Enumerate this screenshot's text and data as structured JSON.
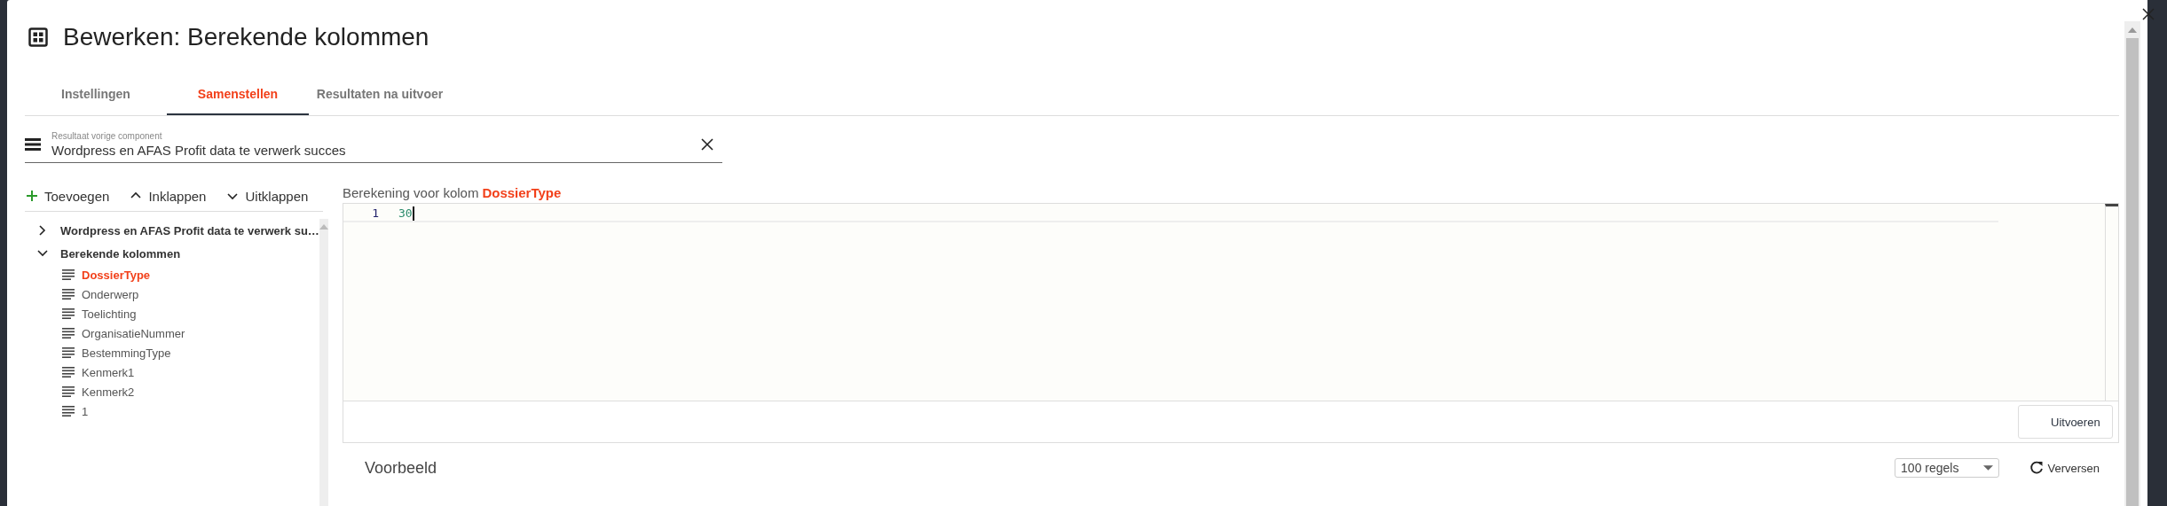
{
  "dialog": {
    "title": "Bewerken: Berekende kolommen"
  },
  "tabs": [
    {
      "label": "Instellingen",
      "selected": false
    },
    {
      "label": "Samenstellen",
      "selected": true
    },
    {
      "label": "Resultaten na uitvoer",
      "selected": false
    }
  ],
  "source_field": {
    "label": "Resultaat vorige component",
    "value": "Wordpress en AFAS Profit data te verwerk succes"
  },
  "toolbar": [
    {
      "label": "Toevoegen",
      "kind": "add"
    },
    {
      "label": "Inklappen",
      "kind": "collapse"
    },
    {
      "label": "Uitklappen",
      "kind": "expand"
    }
  ],
  "tree": [
    {
      "label": "Wordpress en AFAS Profit data te verwerk su…",
      "expanded": false
    },
    {
      "label": "Berekende kolommen",
      "expanded": true,
      "children": [
        {
          "label": "DossierType",
          "selected": true
        },
        {
          "label": "Onderwerp",
          "selected": false
        },
        {
          "label": "Toelichting",
          "selected": false
        },
        {
          "label": "OrganisatieNummer",
          "selected": false
        },
        {
          "label": "BestemmingType",
          "selected": false
        },
        {
          "label": "Kenmerk1",
          "selected": false
        },
        {
          "label": "Kenmerk2",
          "selected": false
        },
        {
          "label": "1",
          "selected": false
        }
      ]
    }
  ],
  "editor": {
    "caption": "Berekening voor kolom **DossierType**",
    "lines": [
      {
        "number": "1",
        "code": "30"
      }
    ],
    "run_button": "Uitvoeren"
  },
  "preview": {
    "title": "Voorbeeld",
    "rows_select": "100 regels",
    "refresh_button": "Verversen"
  }
}
